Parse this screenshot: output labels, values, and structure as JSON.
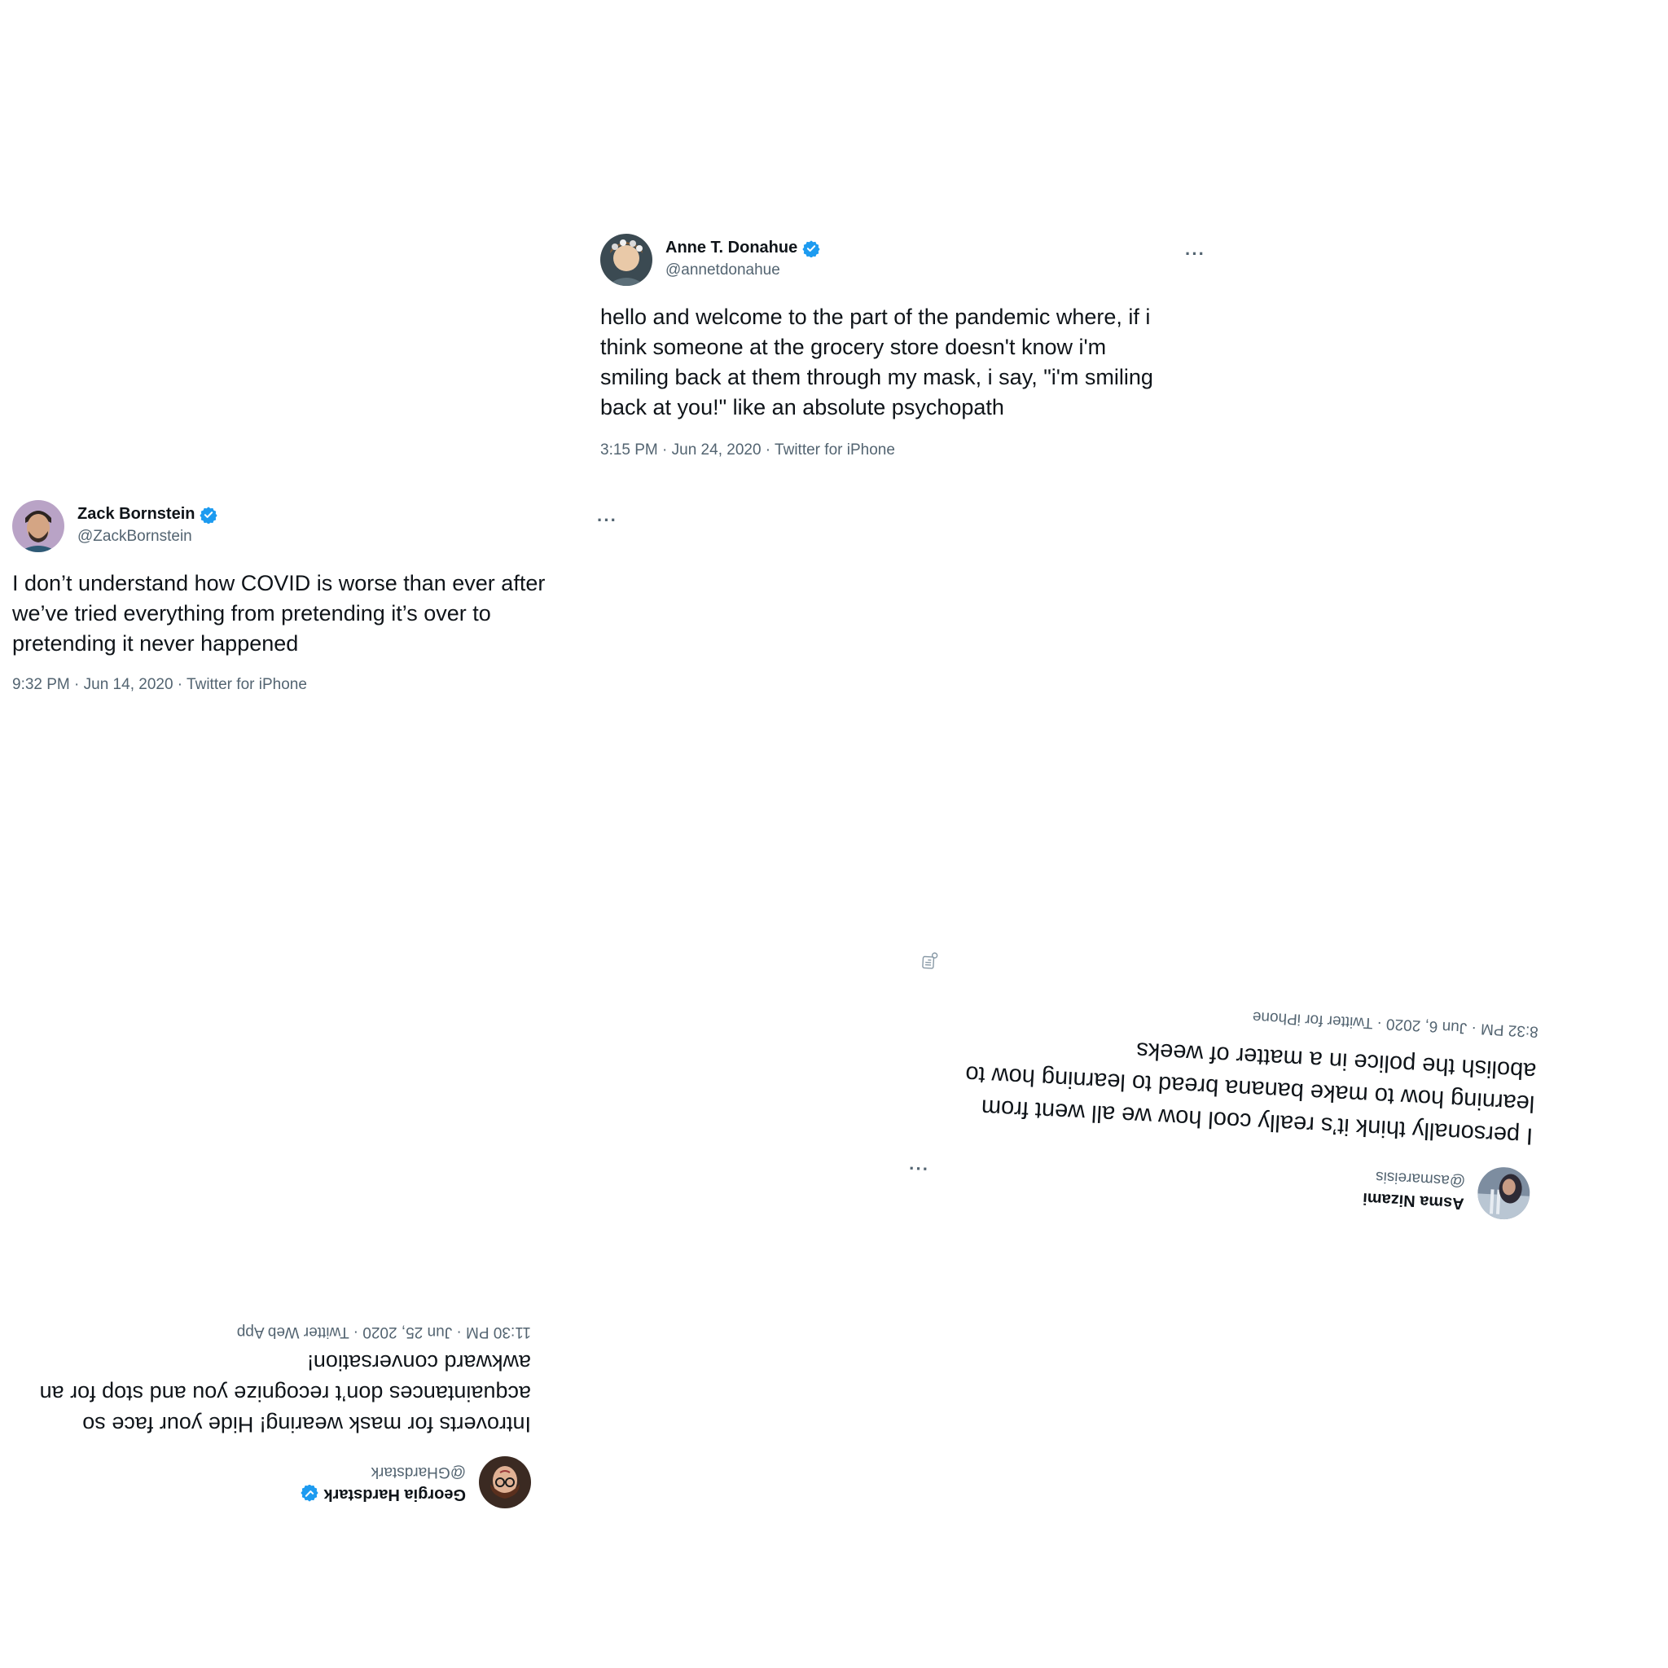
{
  "tweets": {
    "anne": {
      "name": "Anne T. Donahue",
      "handle": "@annetdonahue",
      "text_lines": [
        "hello and welcome to the part of the pandemic where, if i",
        "think someone at the grocery store doesn't know i'm",
        "smiling back at them through my mask, i say, \"i'm smiling",
        "back at you!\" like an absolute psychopath"
      ],
      "meta": "3:15 PM · Jun 24, 2020 · Twitter for iPhone",
      "verified": true,
      "more": "···"
    },
    "zack": {
      "name": "Zack Bornstein",
      "handle": "@ZackBornstein",
      "text_lines": [
        "I don’t understand how COVID is worse than ever after",
        "we’ve tried everything from pretending it’s over to",
        "pretending it never happened"
      ],
      "meta": "9:32 PM · Jun 14, 2020 · Twitter for iPhone",
      "verified": true,
      "more": "···"
    },
    "asma": {
      "name": "Asma Nizami",
      "handle": "@asmareisis",
      "text_lines": [
        "I personally think it’s really cool how we all went from",
        "learning how to make banana bread to learning how to",
        "abolish the police in a matter of weeks"
      ],
      "meta": "8:32 PM · Jun 6, 2020 · Twitter for iPhone",
      "verified": false,
      "more": "···"
    },
    "georgia": {
      "name": "Georgia Hardstark",
      "handle": "@GHardstark",
      "text_lines": [
        "Introverts for mask wearing! Hide your face so",
        "acquaintances don’t recognize you and stop for an",
        "awkward conversation!"
      ],
      "meta": "11:30 PM · Jun 25, 2020 · Twitter Web App",
      "verified": true,
      "more": "···"
    }
  },
  "colors": {
    "text": "#0f1419",
    "secondary": "#536471",
    "verified_blue": "#1d9bf0"
  }
}
